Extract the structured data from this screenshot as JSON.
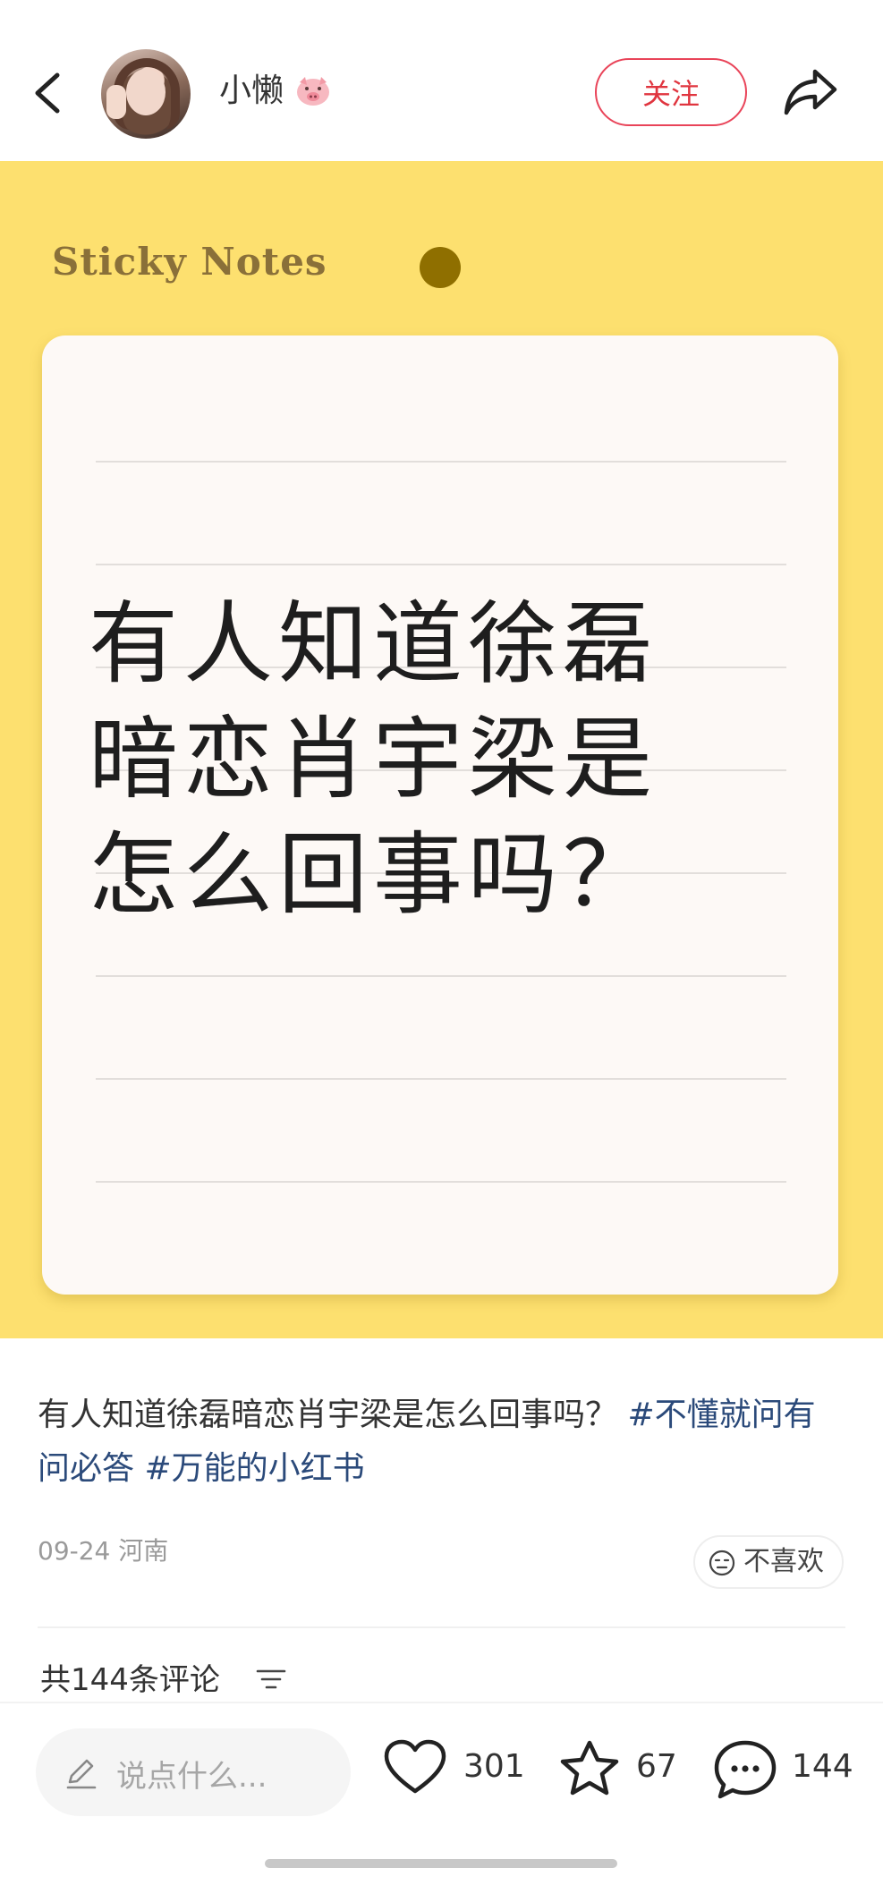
{
  "header": {
    "username": "小懒",
    "follow_label": "关注"
  },
  "cover": {
    "brand": "Sticky Notes",
    "lines": [
      "有人知道徐磊",
      "暗恋肖宇梁是",
      "怎么回事吗？"
    ]
  },
  "post": {
    "text": "有人知道徐磊暗恋肖宇梁是怎么回事吗？",
    "tags": [
      "#不懂就问有问必答",
      "#万能的小红书"
    ],
    "date": "09-24",
    "location": "河南",
    "dislike_label": "不喜欢"
  },
  "comments": {
    "count_label": "共144条评论"
  },
  "bottom_bar": {
    "input_placeholder": "说点什么...",
    "likes": "301",
    "collects": "67",
    "comments": "144"
  },
  "colors": {
    "cover_bg": "#fde06f",
    "follow": "#e94459",
    "tag": "#2b4a7a"
  }
}
